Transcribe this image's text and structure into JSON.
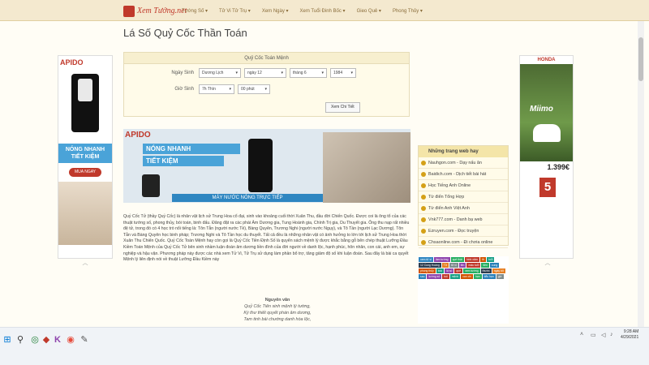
{
  "header": {
    "logo_text": "Xem Tướng.net",
    "nav": [
      "Tướng Số ▾",
      "Tử Vi Tử Trụ ▾",
      "Xem Ngày ▾",
      "Xem Tuổi Đinh Bốc ▾",
      "Gieo Quẻ ▾",
      "Phong Thủy ▾"
    ]
  },
  "page_title": "Lá Số Quỷ Cốc Thần Toán",
  "form": {
    "heading": "Quỷ Cốc Toán Mệnh",
    "dob_label": "Ngày Sinh",
    "calendar": "Dương Lịch",
    "day": "ngày 12",
    "month": "tháng 6",
    "year": "1984",
    "tob_label": "Giờ Sinh",
    "hour": "7h Thìn",
    "minute": "00 phút",
    "submit": "Xem Chi Tiết"
  },
  "ads": {
    "left": {
      "brand": "APIDO",
      "text": "NÓNG NHANH TIẾT KIỆM",
      "cta": "MUA NGAY"
    },
    "banner": {
      "brand": "APIDO",
      "line1": "NÓNG NHANH",
      "line2": "TIẾT KIỆM",
      "strip": "MÁY NƯỚC NÓNG TRỰC TIẾP"
    },
    "right": {
      "brand": "HONDA",
      "model": "Miimo",
      "price": "1.399€",
      "badge": "5"
    }
  },
  "intro_text": "Quỷ Cốc Tử (thầy Quỷ Cốc) là nhân vật lịch sử Trung Hoa cổ đại, sinh vào khoảng cuối thời Xuân Thu, đầu đời Chiến Quốc. Được coi là ông tổ của các thuật tướng số, phong thủy, bói toán, binh đấu. Đăng đặt ra các phái Âm Dương gia, Tung Hoành gia, Chính Trị gia, Du Thuyết gia. Ông thu nạp rất nhiều đệ tử, trong đó có 4 học trò nổi tiếng là: Tôn Tẫn (người nước Tề), Bàng Quyên, Trương Nghi (người nước Ngụy), và Tô Tần (người Lạc Dương). Tôn Tẫn và Bàng Quyên học binh pháp; Trương Nghi và Tô Tần học du thuyết. Tất cả đều là những nhân vật có ảnh hưởng to lớn tới lịch sử Trung Hoa thời Xuân Thu Chiến Quốc. Quỷ Cốc Toán Mệnh hay còn gọi là Quỷ Cốc Tiền Định Số là quyển sách mệnh lý được khắc bằng gỗ bên chép thuật Lưỡng Đầu Kiềm Toán Mệnh của Quỷ Cốc Tử bên sinh nhầm luận đoán âm dương liền đình của đời người về danh lộc, hạnh phúc, hôn nhân, con cái, anh em, sự nghiệp và hậu vận. Phương pháp này được các nhà xem Tử Vi, Tử Trụ sử dụng làm phần bổ trợ, tăng giảm độ số khi luận đoán. Sau đây là bài ca quyết Mệnh lý liên định nói về thuật Lưỡng Đầu Kiềm này",
  "poem": {
    "heading": "Nguyên văn",
    "lines": [
      "Quỷ Cốc Tiên sinh mệnh lý tường,",
      "Kỳ thư thiết quyết phán âm dương,",
      "Tam tinh bài chướng danh hòa lộc,"
    ]
  },
  "sidebar": {
    "heading": "Những trang web hay",
    "links": [
      "Nauhgon.com - Dạy nấu ăn",
      "Baidich.com - Dịch tiết bài hát",
      "Học Tiếng Anh Online",
      "Từ điển Tổng Hợp",
      "Từ điển Anh Việt Anh",
      "Vnk777.com - Danh bạ web",
      "Ezruyen.com - Đọc truyện",
      "Chsaonline.com - Đi chơia online"
    ]
  },
  "tags": [
    {
      "t": "xem tử vi",
      "c": "#2e86c1"
    },
    {
      "t": "làm tướng",
      "c": "#8e44ad"
    },
    {
      "t": "quẻ thật",
      "c": "#27ae60"
    },
    {
      "t": "hình xăm",
      "c": "#c0392b"
    },
    {
      "t": "tử",
      "c": "#d35400"
    },
    {
      "t": "tuổi",
      "c": "#16a085"
    },
    {
      "t": "12 Cung Hoàng",
      "c": "#2c3e50"
    },
    {
      "t": "Tử",
      "c": "#e67e22"
    },
    {
      "t": "tử vi",
      "c": "#7f8c8d"
    },
    {
      "t": "tên",
      "c": "#8e44ad"
    },
    {
      "t": "màu tuổi",
      "c": "#c0392b"
    },
    {
      "t": "tiền",
      "c": "#27ae60"
    },
    {
      "t": "cung",
      "c": "#2980b9"
    },
    {
      "t": "phong thủy",
      "c": "#d35400"
    },
    {
      "t": "bốc",
      "c": "#16a085"
    },
    {
      "t": "lá số",
      "c": "#8e44ad"
    },
    {
      "t": "quẻ",
      "c": "#c0392b"
    },
    {
      "t": "xem tướng",
      "c": "#27ae60"
    },
    {
      "t": "thước",
      "c": "#2c3e50"
    },
    {
      "t": "ngày tốt",
      "c": "#e67e22"
    },
    {
      "t": "sao",
      "c": "#2980b9"
    },
    {
      "t": "tướng số",
      "c": "#8e44ad"
    },
    {
      "t": "bói",
      "c": "#c0392b"
    },
    {
      "t": "mệnh",
      "c": "#16a085"
    },
    {
      "t": "can chi",
      "c": "#d35400"
    },
    {
      "t": "hạn",
      "c": "#27ae60"
    },
    {
      "t": "tiểu hạn",
      "c": "#2980b9"
    },
    {
      "t": "giờ",
      "c": "#7f8c8d"
    }
  ],
  "taskbar": {
    "time": "9:28 AM",
    "date": "4/29/2021",
    "icons": [
      "windows-icon",
      "search-icon",
      "task-view-icon",
      "edge-icon",
      "k-icon",
      "chrome-icon",
      "notepad-icon"
    ]
  }
}
